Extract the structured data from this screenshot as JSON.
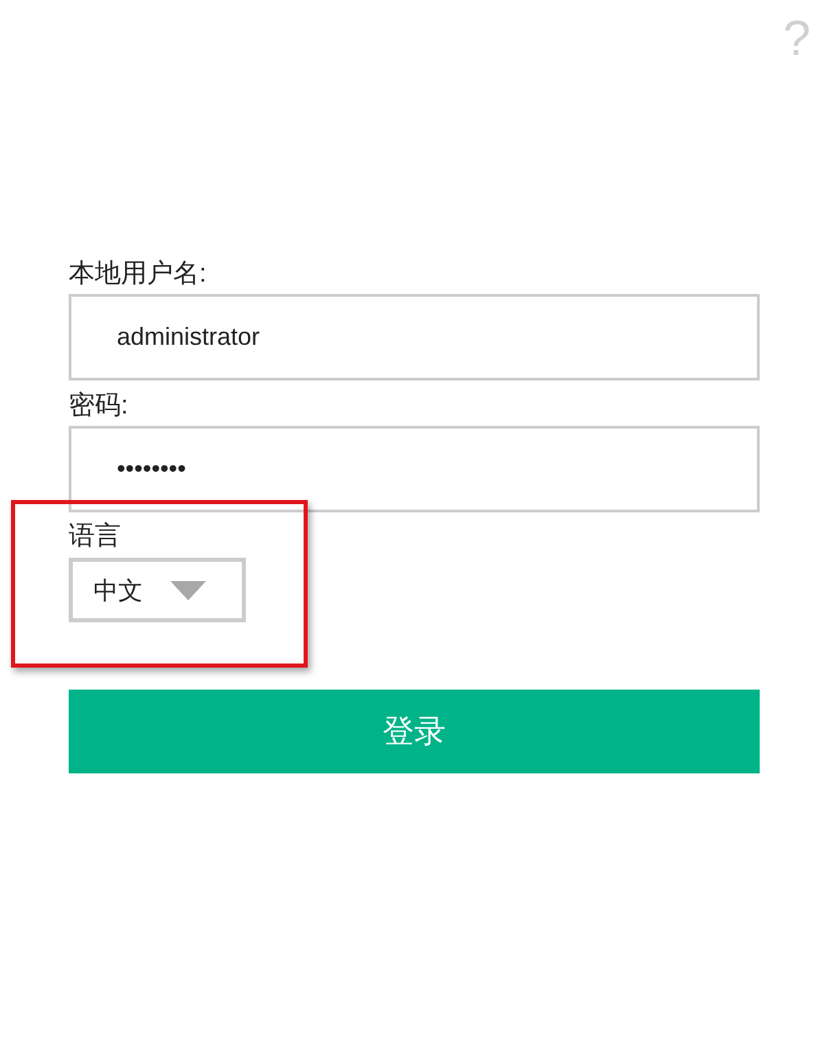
{
  "help": {
    "icon": "?"
  },
  "fields": [
    {
      "label": "本地用户名:",
      "value": "administrator"
    },
    {
      "label": "密码:",
      "value": "••••••••"
    }
  ],
  "language": {
    "label": "语言",
    "value": "中文",
    "highlighted": true
  },
  "login_button": {
    "label": "登录"
  }
}
